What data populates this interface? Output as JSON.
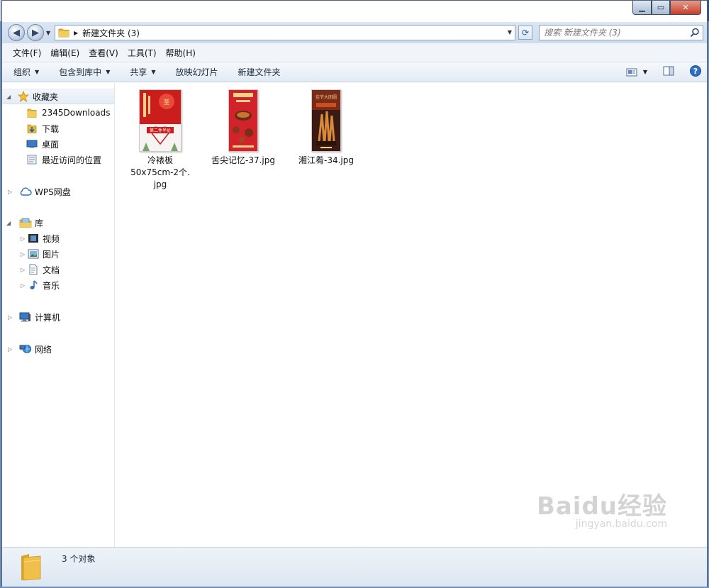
{
  "window": {
    "controls": {
      "minimize": "▁",
      "maximize": "▭",
      "close": "✕"
    }
  },
  "address": {
    "path": "新建文件夹 (3)"
  },
  "search": {
    "placeholder": "搜索 新建文件夹 (3)"
  },
  "menu": [
    "文件(F)",
    "编辑(E)",
    "查看(V)",
    "工具(T)",
    "帮助(H)"
  ],
  "commands": {
    "organize": "组织",
    "include_in_library": "包含到库中",
    "share": "共享",
    "slideshow": "放映幻灯片",
    "new_folder": "新建文件夹"
  },
  "sidebar": {
    "favorites": "收藏夹",
    "favorites_items": [
      "2345Downloads",
      "下载",
      "桌面",
      "最近访问的位置"
    ],
    "wps": "WPS网盘",
    "libraries": "库",
    "library_items": [
      "视频",
      "图片",
      "文档",
      "音乐"
    ],
    "computer": "计算机",
    "network": "网络"
  },
  "files": [
    {
      "name": "冷裱板50x75cm-2个.jpg",
      "line1": "冷裱板",
      "line2": "50x75cm-2个.",
      "line3": "jpg",
      "thumb_text": "第二件半价"
    },
    {
      "name": "舌尖记忆-37.jpg",
      "line1": "舌尖记忆-37.jpg"
    },
    {
      "name": "湘江肴-34.jpg",
      "line1": "湘江肴-34.jpg",
      "thumb_text": "佳节大团圆"
    }
  ],
  "status": {
    "count_text": "3 个对象"
  },
  "watermark": {
    "main": "Baidu经验",
    "sub": "jingyan.baidu.com"
  },
  "colors": {
    "accent": "#1f5fa5",
    "folder": "#e8b93a",
    "selection": "#e4ecf6"
  }
}
